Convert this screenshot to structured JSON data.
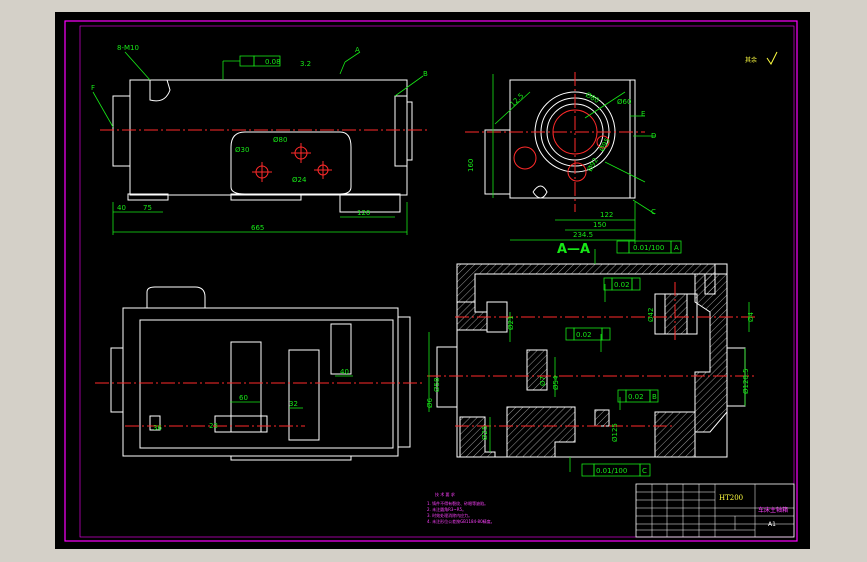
{
  "colors": {
    "background": "#000000",
    "frame": "#ff00ff",
    "outline": "#ffffff",
    "centerline": "#ff2a2a",
    "dimension": "#17e817",
    "notes": "#ff40ff",
    "titleblock_text": "#ffff40"
  },
  "top_view": {
    "tol_flatness": "0.08",
    "roughness": "3.2",
    "thread_label": "8-M10",
    "ref_a": "A",
    "ref_b": "B",
    "ref_f": "F",
    "dims": {
      "d40": "40",
      "d75": "75",
      "d120": "120",
      "d665": "665",
      "d30": "Ø30",
      "d80": "Ø80",
      "d24": "Ø24"
    }
  },
  "side_view": {
    "dims": {
      "d160": "160",
      "d122": "122",
      "d150": "150",
      "d2345": "234.5",
      "d125": "12.5",
      "d80": "Ø80",
      "d92": "Ø92",
      "d95": "Ø95",
      "d60": "Ø60"
    },
    "ref_e": "E",
    "ref_d": "D",
    "ref_c": "C"
  },
  "section": {
    "title": "A—A",
    "tol_top": "0.01/100",
    "tol_bottom": "0.01/100",
    "datum_a": "A",
    "datum_c": "C",
    "tol_02a": "0.02",
    "tol_02b": "0.02",
    "tol_02c": "0.02",
    "datum_b": "B",
    "dims": {
      "d21": "Ø21",
      "d42": "Ø42",
      "d4": "Ø4",
      "d6": "Ø6",
      "d58": "Ø58",
      "d7": "Ø7",
      "d54": "Ø54",
      "d1205": "Ø120.5",
      "d25": "Ø25",
      "d125": "Ø125"
    }
  },
  "front_view": {
    "dims": {
      "d60": "60",
      "d32": "32",
      "d40": "40",
      "d36": "36",
      "d23": "23"
    }
  },
  "roughness_mark": "其余",
  "notes": {
    "heading": "技 术 要 求",
    "lines": [
      "1. 铸件不得有裂纹、砂眼等缺陷。",
      "2. 未注圆角R3~R5。",
      "3. 时效处理消除内应力。",
      "4. 未注形位公差按GB1184-80精度。"
    ]
  },
  "title_block": {
    "material": "HT200",
    "part_name": "车床主轴箱",
    "sheet": "A1"
  }
}
